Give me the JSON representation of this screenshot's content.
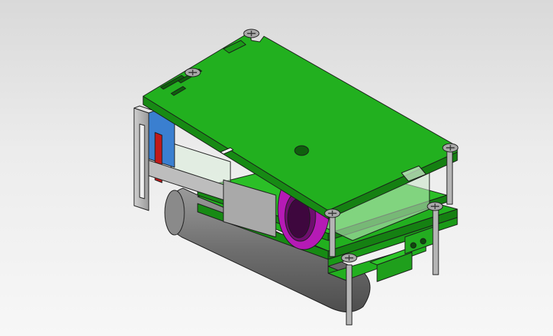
{
  "scene": {
    "view": "isometric",
    "assembly_parts": [
      "top-circuit-board",
      "bottom-circuit-board",
      "metal-mounting-bracket",
      "gray-cylindrical-body",
      "purple-gear-ring",
      "blue-component",
      "red-component",
      "green-connector-block",
      "transparent-enclosure",
      "standoff-posts",
      "phillips-screws"
    ],
    "colors": {
      "background_top": "#d9d9d9",
      "background_bottom": "#f7f7f7",
      "pcb_green": "#22b01f",
      "pcb_green_dark": "#178a14",
      "bracket_gray": "#b3b3b3",
      "cylinder_gray": "#7e7e7e",
      "gear_purple": "#b51ab5",
      "blue_part": "#3a7fd0",
      "red_part": "#c21a1a",
      "screw_gray": "#a8a8a8"
    }
  }
}
